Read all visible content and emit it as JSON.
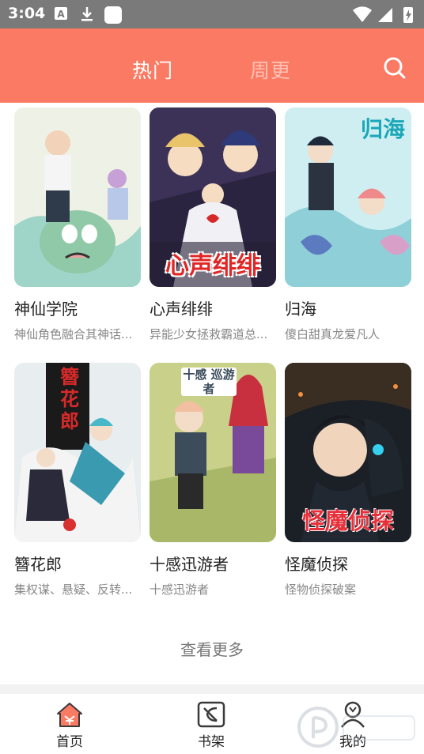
{
  "status_bar": {
    "time": "3:04"
  },
  "header": {
    "tabs": [
      {
        "label": "热门",
        "active": true
      },
      {
        "label": "周更",
        "active": false
      }
    ]
  },
  "comics": [
    {
      "title": "神仙学院",
      "desc": "神仙角色融合其神话...",
      "cover_text": ""
    },
    {
      "title": "心声绯绯",
      "desc": "异能少女拯救霸道总...",
      "cover_text": "心声绯绯"
    },
    {
      "title": "归海",
      "desc": "傻白甜真龙爱凡人",
      "cover_text": "归海"
    },
    {
      "title": "簪花郎",
      "desc": "集权谋、悬疑、反转...",
      "cover_text": "簪花郎"
    },
    {
      "title": "十感迅游者",
      "desc": "十感迅游者",
      "cover_text": "十感 巡游者"
    },
    {
      "title": "怪魔侦探",
      "desc": "怪物侦探破案",
      "cover_text": "怪魔侦探"
    }
  ],
  "more_label": "查看更多",
  "bottom_nav": [
    {
      "label": "首页",
      "icon": "home-icon",
      "active": true
    },
    {
      "label": "书架",
      "icon": "bookshelf-icon",
      "active": false
    },
    {
      "label": "我的",
      "icon": "profile-icon",
      "active": false
    }
  ],
  "colors": {
    "accent": "#fb7a63",
    "inactive_tab": "#ffc2b6"
  }
}
